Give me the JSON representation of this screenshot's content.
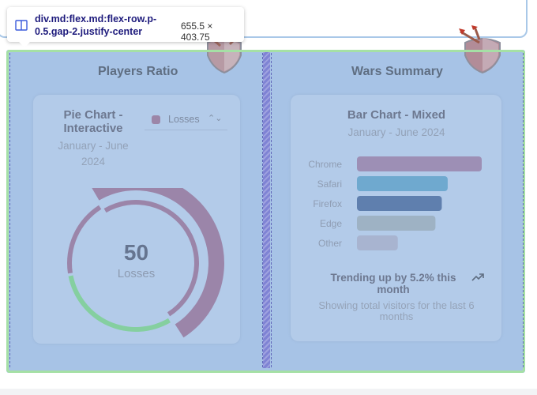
{
  "tooltip": {
    "selector": "div.md:flex.md:flex-row.p-0.5.gap-2.justify-center",
    "size": "655.5 × 403.75"
  },
  "panels": {
    "left_title": "Players Ratio",
    "right_title": "Wars Summary"
  },
  "pie_card": {
    "title": "Pie Chart - Interactive",
    "subtitle": "January - June 2024",
    "select_value": "Losses",
    "center_value": "50",
    "center_label": "Losses"
  },
  "bar_card": {
    "title": "Bar Chart - Mixed",
    "subtitle": "January - June 2024",
    "trend": "Trending up by 5.2% this month",
    "note": "Showing total visitors for the last 6 months"
  },
  "chart_data": [
    {
      "type": "pie",
      "title": "Pie Chart - Interactive",
      "slices": [
        {
          "name": "Losses",
          "value": 50,
          "color": "#9b85a9",
          "active": true
        },
        {
          "name": "",
          "value": 31,
          "color": "#85cfa0"
        },
        {
          "name": "",
          "value": 19,
          "color": "#9b85a9"
        }
      ]
    },
    {
      "type": "bar",
      "orientation": "horizontal",
      "title": "Bar Chart - Mixed",
      "categories": [
        "Chrome",
        "Safari",
        "Firefox",
        "Edge",
        "Other"
      ],
      "values": [
        275,
        200,
        187,
        173,
        90
      ],
      "colors": [
        "#9d8fb5",
        "#6fa9cf",
        "#5f7fae",
        "#9eb2c4",
        "#a8b4d0"
      ],
      "xlim": [
        0,
        275
      ]
    }
  ],
  "colors": {
    "highlight": "#a7c3e6",
    "gap": "#7f83d4",
    "border_green": "#a5e0a5",
    "text_title": "#5f6e82"
  }
}
